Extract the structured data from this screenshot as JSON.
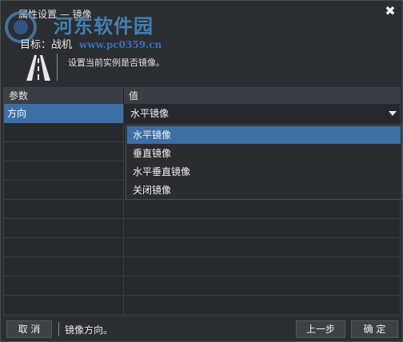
{
  "title_bar": {
    "title": "属性设置 — 镜像",
    "close_glyph": "✖"
  },
  "watermark": {
    "text": "河东软件园",
    "url": "www.pc0359.cn"
  },
  "target": {
    "label": "目标：战机"
  },
  "header": {
    "description": "设置当前实例是否镜像。",
    "icon": "road-icon"
  },
  "table": {
    "headers": {
      "param": "参数",
      "value": "值"
    },
    "rows": [
      {
        "param": "方向",
        "value": "水平镜像"
      }
    ]
  },
  "dropdown": {
    "options": [
      "水平镜像",
      "垂直镜像",
      "水平垂直镜像",
      "关闭镜像"
    ],
    "selected": "水平镜像"
  },
  "footer": {
    "cancel_label": "取 消",
    "hint": "镜像方向。",
    "prev_label": "上一步",
    "ok_label": "确 定"
  },
  "colors": {
    "accent": "#3d6fa5",
    "background": "#2b2d30"
  }
}
